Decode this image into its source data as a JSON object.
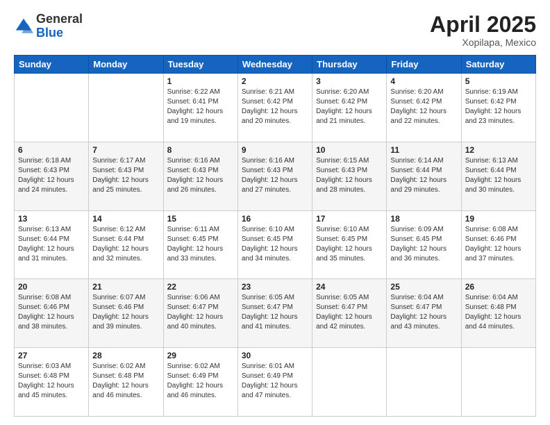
{
  "logo": {
    "general": "General",
    "blue": "Blue"
  },
  "title": {
    "month": "April 2025",
    "location": "Xopilapa, Mexico"
  },
  "days_of_week": [
    "Sunday",
    "Monday",
    "Tuesday",
    "Wednesday",
    "Thursday",
    "Friday",
    "Saturday"
  ],
  "weeks": [
    [
      {
        "day": "",
        "info": ""
      },
      {
        "day": "",
        "info": ""
      },
      {
        "day": "1",
        "info": "Sunrise: 6:22 AM\nSunset: 6:41 PM\nDaylight: 12 hours and 19 minutes."
      },
      {
        "day": "2",
        "info": "Sunrise: 6:21 AM\nSunset: 6:42 PM\nDaylight: 12 hours and 20 minutes."
      },
      {
        "day": "3",
        "info": "Sunrise: 6:20 AM\nSunset: 6:42 PM\nDaylight: 12 hours and 21 minutes."
      },
      {
        "day": "4",
        "info": "Sunrise: 6:20 AM\nSunset: 6:42 PM\nDaylight: 12 hours and 22 minutes."
      },
      {
        "day": "5",
        "info": "Sunrise: 6:19 AM\nSunset: 6:42 PM\nDaylight: 12 hours and 23 minutes."
      }
    ],
    [
      {
        "day": "6",
        "info": "Sunrise: 6:18 AM\nSunset: 6:43 PM\nDaylight: 12 hours and 24 minutes."
      },
      {
        "day": "7",
        "info": "Sunrise: 6:17 AM\nSunset: 6:43 PM\nDaylight: 12 hours and 25 minutes."
      },
      {
        "day": "8",
        "info": "Sunrise: 6:16 AM\nSunset: 6:43 PM\nDaylight: 12 hours and 26 minutes."
      },
      {
        "day": "9",
        "info": "Sunrise: 6:16 AM\nSunset: 6:43 PM\nDaylight: 12 hours and 27 minutes."
      },
      {
        "day": "10",
        "info": "Sunrise: 6:15 AM\nSunset: 6:43 PM\nDaylight: 12 hours and 28 minutes."
      },
      {
        "day": "11",
        "info": "Sunrise: 6:14 AM\nSunset: 6:44 PM\nDaylight: 12 hours and 29 minutes."
      },
      {
        "day": "12",
        "info": "Sunrise: 6:13 AM\nSunset: 6:44 PM\nDaylight: 12 hours and 30 minutes."
      }
    ],
    [
      {
        "day": "13",
        "info": "Sunrise: 6:13 AM\nSunset: 6:44 PM\nDaylight: 12 hours and 31 minutes."
      },
      {
        "day": "14",
        "info": "Sunrise: 6:12 AM\nSunset: 6:44 PM\nDaylight: 12 hours and 32 minutes."
      },
      {
        "day": "15",
        "info": "Sunrise: 6:11 AM\nSunset: 6:45 PM\nDaylight: 12 hours and 33 minutes."
      },
      {
        "day": "16",
        "info": "Sunrise: 6:10 AM\nSunset: 6:45 PM\nDaylight: 12 hours and 34 minutes."
      },
      {
        "day": "17",
        "info": "Sunrise: 6:10 AM\nSunset: 6:45 PM\nDaylight: 12 hours and 35 minutes."
      },
      {
        "day": "18",
        "info": "Sunrise: 6:09 AM\nSunset: 6:45 PM\nDaylight: 12 hours and 36 minutes."
      },
      {
        "day": "19",
        "info": "Sunrise: 6:08 AM\nSunset: 6:46 PM\nDaylight: 12 hours and 37 minutes."
      }
    ],
    [
      {
        "day": "20",
        "info": "Sunrise: 6:08 AM\nSunset: 6:46 PM\nDaylight: 12 hours and 38 minutes."
      },
      {
        "day": "21",
        "info": "Sunrise: 6:07 AM\nSunset: 6:46 PM\nDaylight: 12 hours and 39 minutes."
      },
      {
        "day": "22",
        "info": "Sunrise: 6:06 AM\nSunset: 6:47 PM\nDaylight: 12 hours and 40 minutes."
      },
      {
        "day": "23",
        "info": "Sunrise: 6:05 AM\nSunset: 6:47 PM\nDaylight: 12 hours and 41 minutes."
      },
      {
        "day": "24",
        "info": "Sunrise: 6:05 AM\nSunset: 6:47 PM\nDaylight: 12 hours and 42 minutes."
      },
      {
        "day": "25",
        "info": "Sunrise: 6:04 AM\nSunset: 6:47 PM\nDaylight: 12 hours and 43 minutes."
      },
      {
        "day": "26",
        "info": "Sunrise: 6:04 AM\nSunset: 6:48 PM\nDaylight: 12 hours and 44 minutes."
      }
    ],
    [
      {
        "day": "27",
        "info": "Sunrise: 6:03 AM\nSunset: 6:48 PM\nDaylight: 12 hours and 45 minutes."
      },
      {
        "day": "28",
        "info": "Sunrise: 6:02 AM\nSunset: 6:48 PM\nDaylight: 12 hours and 46 minutes."
      },
      {
        "day": "29",
        "info": "Sunrise: 6:02 AM\nSunset: 6:49 PM\nDaylight: 12 hours and 46 minutes."
      },
      {
        "day": "30",
        "info": "Sunrise: 6:01 AM\nSunset: 6:49 PM\nDaylight: 12 hours and 47 minutes."
      },
      {
        "day": "",
        "info": ""
      },
      {
        "day": "",
        "info": ""
      },
      {
        "day": "",
        "info": ""
      }
    ]
  ]
}
